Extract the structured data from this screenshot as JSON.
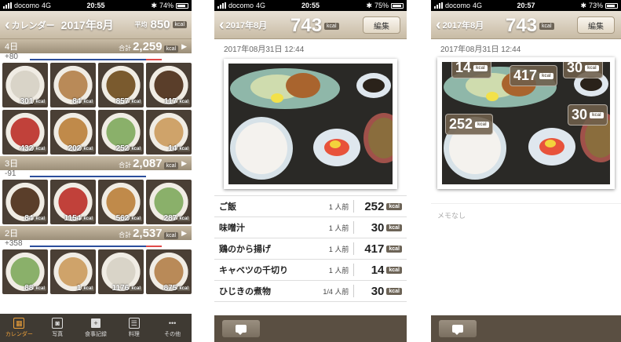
{
  "phone1": {
    "status": {
      "carrier": "docomo",
      "network": "4G",
      "time": "20:55",
      "battery": "74%"
    },
    "nav": {
      "back_label": "カレンダー",
      "title": "2017年8月",
      "avg_label": "平均",
      "avg_value": "850",
      "unit": "kcal"
    },
    "days": [
      {
        "label": "4日",
        "total_label": "合計",
        "total": "2,259",
        "unit": "kcal",
        "diff": "+80",
        "items": [
          {
            "kcal": "301"
          },
          {
            "kcal": "84"
          },
          {
            "kcal": "857"
          },
          {
            "kcal": "117"
          },
          {
            "kcal": "432"
          },
          {
            "kcal": "202"
          },
          {
            "kcal": "252"
          },
          {
            "kcal": "14"
          }
        ]
      },
      {
        "label": "3日",
        "total_label": "合計",
        "total": "2,087",
        "unit": "kcal",
        "diff": "-91",
        "items": [
          {
            "kcal": "84"
          },
          {
            "kcal": "1154"
          },
          {
            "kcal": "562"
          },
          {
            "kcal": "287"
          }
        ]
      },
      {
        "label": "2日",
        "total_label": "合計",
        "total": "2,537",
        "unit": "kcal",
        "diff": "+358",
        "items": [
          {
            "kcal": "88"
          },
          {
            "kcal": "1"
          },
          {
            "kcal": "1176"
          },
          {
            "kcal": "875"
          }
        ]
      }
    ],
    "tabs": [
      "カレンダー",
      "写真",
      "食事記録",
      "料理",
      "その他"
    ]
  },
  "phone2": {
    "status": {
      "carrier": "docomo",
      "network": "4G",
      "time": "20:55",
      "battery": "75%"
    },
    "nav": {
      "back_label": "2017年8月",
      "total": "743",
      "unit": "kcal",
      "edit_label": "編集"
    },
    "datetime": "2017年08月31日 12:44",
    "items": [
      {
        "name": "ご飯",
        "portion": "1 人前",
        "kcal": "252",
        "unit": "kcal"
      },
      {
        "name": "味噌汁",
        "portion": "1 人前",
        "kcal": "30",
        "unit": "kcal"
      },
      {
        "name": "鶏のから揚げ",
        "portion": "1 人前",
        "kcal": "417",
        "unit": "kcal"
      },
      {
        "name": "キャベツの千切り",
        "portion": "1 人前",
        "kcal": "14",
        "unit": "kcal"
      },
      {
        "name": "ひじきの煮物",
        "portion": "1/4 人前",
        "kcal": "30",
        "unit": "kcal"
      }
    ]
  },
  "phone3": {
    "status": {
      "carrier": "docomo",
      "network": "4G",
      "time": "20:57",
      "battery": "73%"
    },
    "nav": {
      "back_label": "2017年8月",
      "total": "743",
      "unit": "kcal",
      "edit_label": "編集"
    },
    "datetime": "2017年08月31日 12:44",
    "tags": [
      {
        "kcal": "14",
        "unit": "kcal"
      },
      {
        "kcal": "417",
        "unit": "kcal"
      },
      {
        "kcal": "30",
        "unit": "kcal"
      },
      {
        "kcal": "252",
        "unit": "kcal"
      },
      {
        "kcal": "30",
        "unit": "kcal"
      }
    ],
    "memo": "メモなし"
  }
}
